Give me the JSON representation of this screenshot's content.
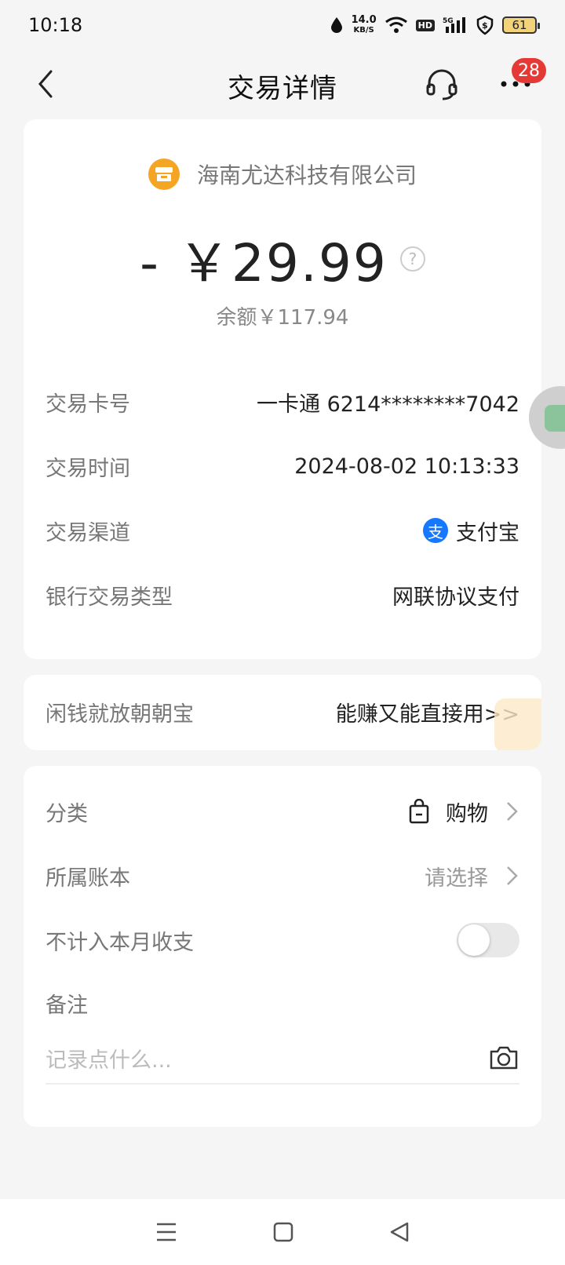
{
  "status_bar": {
    "time": "10:18",
    "net_speed": "14.0",
    "net_unit": "KB/S",
    "hd": "HD",
    "signal": "5G",
    "battery": "61"
  },
  "header": {
    "title": "交易详情",
    "notification_count": "28"
  },
  "transaction": {
    "merchant": "海南尤达科技有限公司",
    "amount": "- ￥29.99",
    "balance": "余额￥117.94",
    "details": [
      {
        "label": "交易卡号",
        "value": "一卡通 6214********7042"
      },
      {
        "label": "交易时间",
        "value": "2024-08-02 10:13:33"
      },
      {
        "label": "交易渠道",
        "value": "支付宝",
        "icon": "alipay-icon"
      },
      {
        "label": "银行交易类型",
        "value": "网联协议支付"
      }
    ]
  },
  "promo": {
    "label": "闲钱就放朝朝宝",
    "link": "能赚又能直接用>>"
  },
  "options": {
    "category_label": "分类",
    "category_value": "购物",
    "ledger_label": "所属账本",
    "ledger_value": "请选择",
    "exclude_label": "不计入本月收支",
    "exclude_on": false,
    "note_label": "备注",
    "note_placeholder": "记录点什么..."
  },
  "colors": {
    "merchant_icon": "#f5a524",
    "badge": "#e53935",
    "alipay": "#1677ff"
  }
}
